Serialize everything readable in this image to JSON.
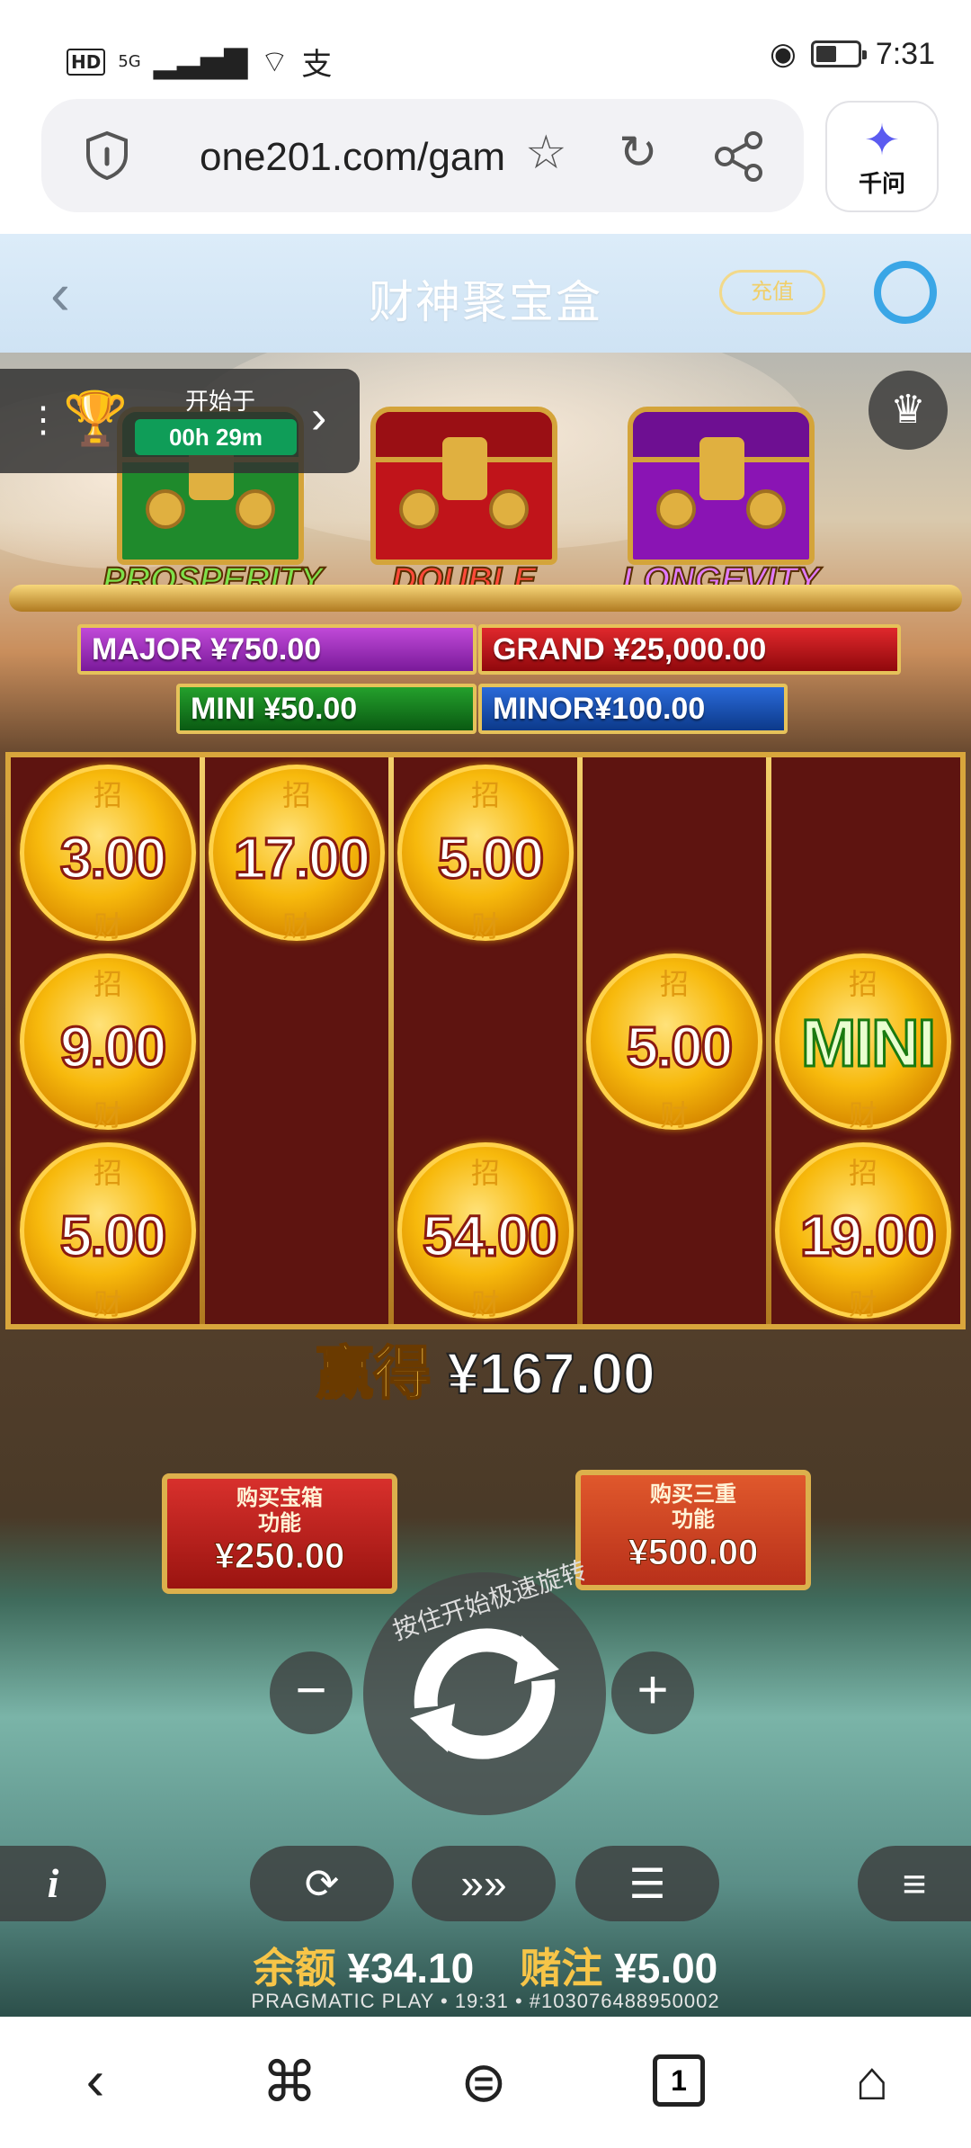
{
  "status_bar": {
    "network": "HD",
    "signal": "5G",
    "carrier_mark": "支",
    "time": "7:31"
  },
  "browser": {
    "url": "one201.com/gam",
    "assistant_label": "千问"
  },
  "header": {
    "title": "财神聚宝盒",
    "recharge_label": "充值"
  },
  "tournament": {
    "starts_label": "开始于",
    "timer": "00h 29m"
  },
  "chests": [
    {
      "label": "PROSPERITY",
      "color": "#1f8a2c",
      "text_color": "#7ee04a"
    },
    {
      "label": "DOUBLE",
      "color": "#c0141a",
      "text_color": "#ff4a3a"
    },
    {
      "label": "LONGEVITY",
      "color": "#8a14b4",
      "text_color": "#e07aff"
    }
  ],
  "jackpots": {
    "major": "MAJOR  ¥750.00",
    "grand": "GRAND  ¥25,000.00",
    "mini": "MINI   ¥50.00",
    "minor": "MINOR¥100.00"
  },
  "grid": {
    "zh_top": "招",
    "zh_bottom": "财",
    "r0c0": "3.00",
    "r0c1": "17.00",
    "r0c2": "5.00",
    "r1c0": "9.00",
    "r1c3": "5.00",
    "r1c4": "MINI",
    "r2c0": "5.00",
    "r2c2": "54.00",
    "r2c4": "19.00"
  },
  "win": {
    "label": "赢得",
    "amount": "¥167.00"
  },
  "buy_buttons": [
    {
      "title": "购买宝箱\n功能",
      "price": "¥250.00"
    },
    {
      "title": "购买三重\n功能",
      "price": "¥500.00"
    }
  ],
  "spin_hint": "按住开始极速旋转",
  "controls": {
    "minus": "−",
    "plus": "+",
    "info": "i"
  },
  "balance": {
    "balance_label": "余额",
    "balance_value": "¥34.10",
    "bet_label": "赌注",
    "bet_value": "¥5.00"
  },
  "footer_text": "PRAGMATIC PLAY • 19:31 • #103076488950002",
  "bottom_nav": {
    "tab_count": "1"
  },
  "colors": {
    "header_bg": "#d6e8f7",
    "tourney_green": "#0f9d58",
    "reel_bg": "#5e1410",
    "gold": "#d8a63c"
  },
  "icons": [
    "shield-icon",
    "star-icon",
    "refresh-icon",
    "share-icon",
    "back-icon",
    "customer-service-icon",
    "trophy-icon",
    "spin-icon",
    "autoplay-icon",
    "turbo-icon",
    "coins-icon",
    "menu-icon",
    "home-icon",
    "tabs-icon"
  ]
}
